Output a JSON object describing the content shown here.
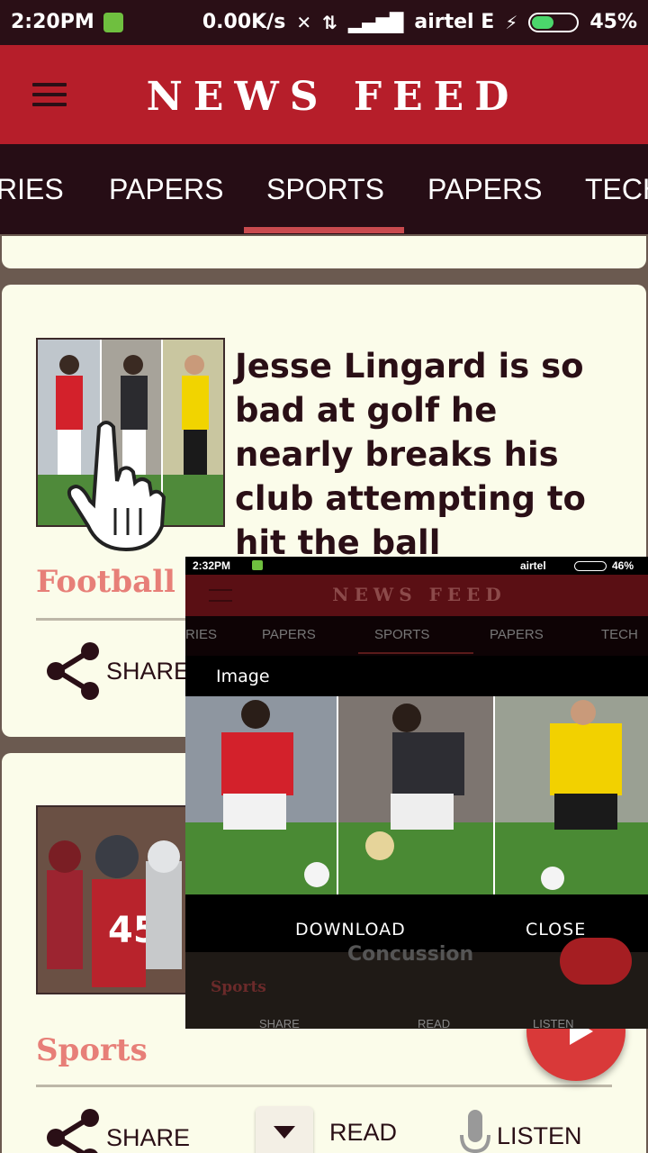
{
  "status_bar": {
    "time": "2:20PM",
    "net_speed": "0.00K/s",
    "carrier": "airtel E",
    "battery": "45%"
  },
  "app_bar": {
    "title": "NEWS FEED"
  },
  "tabs": [
    {
      "label": "RIES"
    },
    {
      "label": "PAPERS"
    },
    {
      "label": "SPORTS",
      "selected": true
    },
    {
      "label": "PAPERS"
    },
    {
      "label": "TECH"
    }
  ],
  "cards": [
    {
      "headline": "Jesse Lingard is so bad at golf he nearly breaks his club attempting to hit the ball",
      "category": "Football",
      "share": "SHARE"
    },
    {
      "category": "Sports",
      "share": "SHARE",
      "read": "READ",
      "listen": "LISTEN"
    }
  ],
  "overlay": {
    "status_time": "2:32PM",
    "status_carrier": "airtel",
    "status_battery": "46%",
    "title": "NEWS FEED",
    "tabs": [
      "RIES",
      "PAPERS",
      "SPORTS",
      "PAPERS",
      "TECH"
    ],
    "image_label": "Image",
    "download": "DOWNLOAD",
    "close": "CLOSE",
    "behind_headline": "Concussion",
    "behind_category": "Sports",
    "behind_share": "SHARE",
    "behind_read": "READ",
    "behind_listen": "LISTEN"
  },
  "colors": {
    "app_bar": "#b61e2a",
    "tab_bar": "#260d15",
    "tab_indicator": "#c84a4e",
    "card": "#fbfcea",
    "category_text": "#e77f78",
    "fab": "#d93939"
  },
  "icons": [
    "menu-icon",
    "share-icon",
    "chevron-down-icon",
    "microphone-icon",
    "play-icon",
    "hand-pointer-icon"
  ]
}
